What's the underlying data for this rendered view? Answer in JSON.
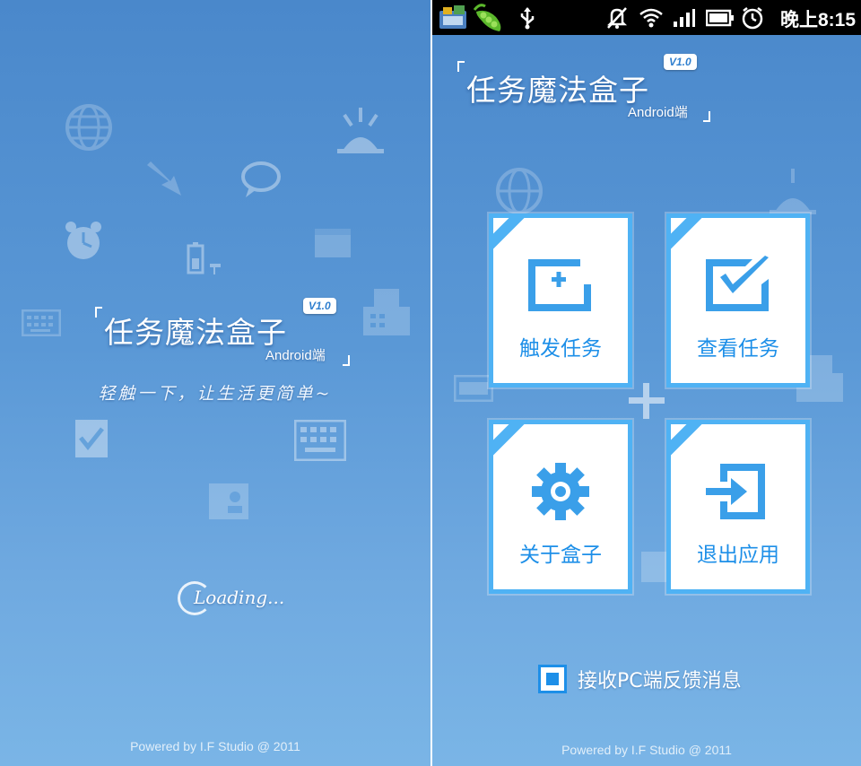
{
  "splash": {
    "app_title": "任务魔法盒子",
    "platform_label": "Android端",
    "version": "V1.0",
    "tagline": "轻触一下，让生活更简单~",
    "loading_text": "Loading...",
    "powered_by": "Powered by I.F Studio @ 2011"
  },
  "main": {
    "status_bar": {
      "time": "晚上8:15",
      "icons": [
        "app-notification-icon",
        "pea-pod-icon",
        "usb-icon",
        "mute-icon",
        "wifi-icon",
        "signal-icon",
        "battery-icon",
        "alarm-icon"
      ]
    },
    "app_title": "任务魔法盒子",
    "platform_label": "Android端",
    "version": "V1.0",
    "tiles": [
      {
        "label": "触发任务",
        "icon": "add-task-icon"
      },
      {
        "label": "查看任务",
        "icon": "check-task-icon"
      },
      {
        "label": "关于盒子",
        "icon": "gear-icon"
      },
      {
        "label": "退出应用",
        "icon": "exit-icon"
      }
    ],
    "feedback_checkbox": {
      "label": "接收PC端反馈消息",
      "checked": true
    },
    "powered_by": "Powered by I.F Studio @ 2011"
  },
  "colors": {
    "accent": "#1d8fe8",
    "tile_border": "#4fb2f4",
    "background": "#5a98d6"
  }
}
